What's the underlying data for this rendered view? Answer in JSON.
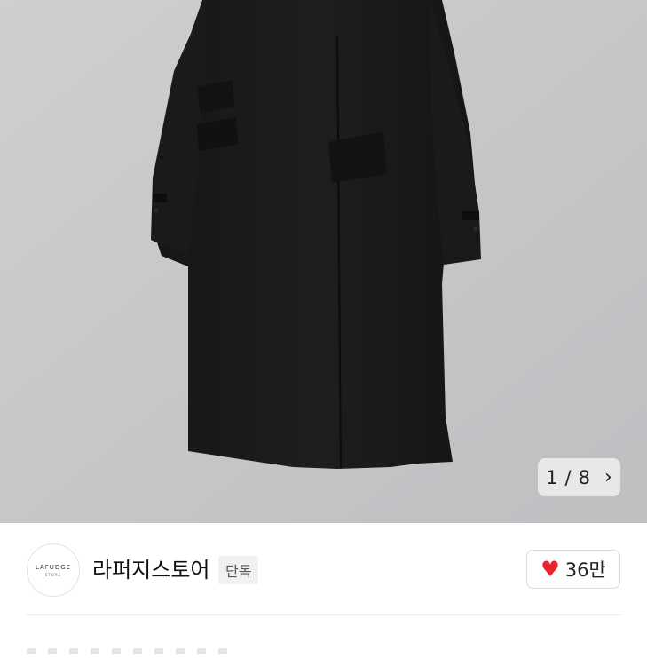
{
  "product_gallery": {
    "image_alt": "",
    "current_index": "1",
    "separator": "/",
    "total": "8",
    "next_icon": "chevron-right-icon"
  },
  "store": {
    "logo_text": "LAFUDGE",
    "logo_subtext": "STORE",
    "name": "라퍼지스토어",
    "badge": "단독"
  },
  "like": {
    "icon": "heart-icon",
    "count": "36만",
    "color": "#e5242d"
  }
}
